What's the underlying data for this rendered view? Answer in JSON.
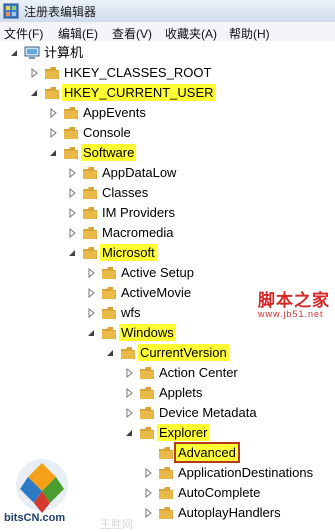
{
  "window": {
    "title": "注册表编辑器"
  },
  "menu": [
    "文件(F)",
    "编辑(E)",
    "查看(V)",
    "收藏夹(A)",
    "帮助(H)"
  ],
  "tree": {
    "root": "计算机",
    "nodes": [
      {
        "label": "HKEY_CLASSES_ROOT",
        "expanded": false,
        "highlight": false
      },
      {
        "label": "HKEY_CURRENT_USER",
        "expanded": true,
        "highlight": true
      },
      {
        "label": "AppEvents",
        "expanded": false,
        "highlight": false
      },
      {
        "label": "Console",
        "expanded": false,
        "highlight": false
      },
      {
        "label": "Software",
        "expanded": true,
        "highlight": true
      },
      {
        "label": "AppDataLow",
        "expanded": false,
        "highlight": false
      },
      {
        "label": "Classes",
        "expanded": false,
        "highlight": false
      },
      {
        "label": "IM Providers",
        "expanded": false,
        "highlight": false
      },
      {
        "label": "Macromedia",
        "expanded": false,
        "highlight": false
      },
      {
        "label": "Microsoft",
        "expanded": true,
        "highlight": true
      },
      {
        "label": "Active Setup",
        "expanded": false,
        "highlight": false
      },
      {
        "label": "ActiveMovie",
        "expanded": false,
        "highlight": false
      },
      {
        "label": "wfs",
        "expanded": false,
        "highlight": false
      },
      {
        "label": "Windows",
        "expanded": true,
        "highlight": true
      },
      {
        "label": "CurrentVersion",
        "expanded": true,
        "highlight": true
      },
      {
        "label": "Action Center",
        "expanded": false,
        "highlight": false
      },
      {
        "label": "Applets",
        "expanded": false,
        "highlight": false
      },
      {
        "label": "Device Metadata",
        "expanded": false,
        "highlight": false
      },
      {
        "label": "Explorer",
        "expanded": true,
        "highlight": true
      },
      {
        "label": "Advanced",
        "expanded": false,
        "highlight": true,
        "selected": true
      },
      {
        "label": "ApplicationDestinations",
        "expanded": false,
        "highlight": false
      },
      {
        "label": "AutoComplete",
        "expanded": false,
        "highlight": false
      },
      {
        "label": "AutoplayHandlers",
        "expanded": false,
        "highlight": false
      }
    ]
  },
  "watermarks": {
    "site_cn": "脚本之家",
    "site_url": "www.jb51.net",
    "logo": "bitsCN.com",
    "faint": "王胜网"
  },
  "colors": {
    "highlight": "#ffff33",
    "selection_border": "#b33b1a",
    "folder": "#e9b94a",
    "watermark_red": "#d42a2a"
  },
  "icons": {
    "folder": "folder-icon",
    "expand": "expand-arrow-icon",
    "collapse": "collapse-arrow-icon",
    "computer": "computer-icon",
    "app": "registry-editor-icon"
  }
}
